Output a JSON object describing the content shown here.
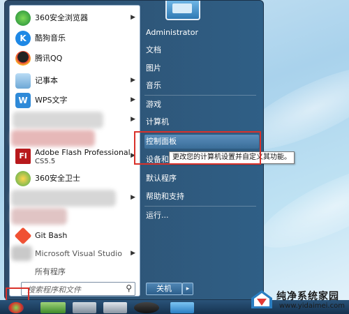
{
  "programs": [
    {
      "label": "360安全浏览器",
      "has_submenu": true,
      "icon": "360-browser-icon"
    },
    {
      "label": "酷狗音乐",
      "has_submenu": false,
      "icon": "kugou-music-icon"
    },
    {
      "label": "腾讯QQ",
      "has_submenu": false,
      "icon": "qq-icon"
    },
    {
      "label": "记事本",
      "has_submenu": true,
      "icon": "notepad-icon"
    },
    {
      "label": "WPS文字",
      "has_submenu": true,
      "icon": "wps-writer-icon"
    },
    {
      "label": "",
      "has_submenu": true,
      "icon": "blurred-app-icon"
    },
    {
      "label": "",
      "has_submenu": false,
      "icon": "blurred-app-icon"
    },
    {
      "label": "Adobe Flash Professional",
      "sublabel": "CS5.5",
      "has_submenu": true,
      "icon": "adobe-flash-icon"
    },
    {
      "label": "360安全卫士",
      "has_submenu": false,
      "icon": "360-safe-icon"
    },
    {
      "label": "",
      "has_submenu": true,
      "icon": "blurred-app-icon"
    },
    {
      "label": "",
      "has_submenu": false,
      "icon": "blurred-app-icon"
    },
    {
      "label": "Git Bash",
      "has_submenu": false,
      "icon": "git-bash-icon"
    },
    {
      "label": "Microsoft Visual Studio",
      "has_submenu": true,
      "icon": "visual-studio-icon"
    },
    {
      "label": "所有程序",
      "has_submenu": false,
      "icon": "all-programs-arrow-icon"
    }
  ],
  "search": {
    "placeholder": "搜索程序和文件"
  },
  "right_menu": {
    "user": "Administrator",
    "documents": "文档",
    "pictures": "图片",
    "music": "音乐",
    "games": "游戏",
    "computer": "计算机",
    "control_panel": "控制面板",
    "devices": "设备和打印机",
    "default_programs": "默认程序",
    "help": "帮助和支持",
    "run": "运行..."
  },
  "tooltip": "更改您的计算机设置并自定义其功能。",
  "shutdown": {
    "label": "关机",
    "arrow": "▸"
  },
  "watermark": {
    "title": "纯净系统家园",
    "url": "www.yidaimei.com"
  },
  "colors": {
    "highlight": "#d9312a",
    "menu_blue": "#2f5f86"
  }
}
